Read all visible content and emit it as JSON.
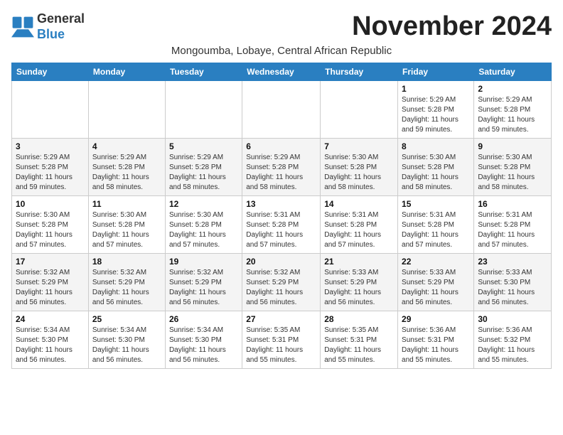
{
  "logo": {
    "text_general": "General",
    "text_blue": "Blue"
  },
  "title": "November 2024",
  "subtitle": "Mongoumba, Lobaye, Central African Republic",
  "days_of_week": [
    "Sunday",
    "Monday",
    "Tuesday",
    "Wednesday",
    "Thursday",
    "Friday",
    "Saturday"
  ],
  "weeks": [
    [
      {
        "day": "",
        "info": ""
      },
      {
        "day": "",
        "info": ""
      },
      {
        "day": "",
        "info": ""
      },
      {
        "day": "",
        "info": ""
      },
      {
        "day": "",
        "info": ""
      },
      {
        "day": "1",
        "info": "Sunrise: 5:29 AM\nSunset: 5:28 PM\nDaylight: 11 hours and 59 minutes."
      },
      {
        "day": "2",
        "info": "Sunrise: 5:29 AM\nSunset: 5:28 PM\nDaylight: 11 hours and 59 minutes."
      }
    ],
    [
      {
        "day": "3",
        "info": "Sunrise: 5:29 AM\nSunset: 5:28 PM\nDaylight: 11 hours and 59 minutes."
      },
      {
        "day": "4",
        "info": "Sunrise: 5:29 AM\nSunset: 5:28 PM\nDaylight: 11 hours and 58 minutes."
      },
      {
        "day": "5",
        "info": "Sunrise: 5:29 AM\nSunset: 5:28 PM\nDaylight: 11 hours and 58 minutes."
      },
      {
        "day": "6",
        "info": "Sunrise: 5:29 AM\nSunset: 5:28 PM\nDaylight: 11 hours and 58 minutes."
      },
      {
        "day": "7",
        "info": "Sunrise: 5:30 AM\nSunset: 5:28 PM\nDaylight: 11 hours and 58 minutes."
      },
      {
        "day": "8",
        "info": "Sunrise: 5:30 AM\nSunset: 5:28 PM\nDaylight: 11 hours and 58 minutes."
      },
      {
        "day": "9",
        "info": "Sunrise: 5:30 AM\nSunset: 5:28 PM\nDaylight: 11 hours and 58 minutes."
      }
    ],
    [
      {
        "day": "10",
        "info": "Sunrise: 5:30 AM\nSunset: 5:28 PM\nDaylight: 11 hours and 57 minutes."
      },
      {
        "day": "11",
        "info": "Sunrise: 5:30 AM\nSunset: 5:28 PM\nDaylight: 11 hours and 57 minutes."
      },
      {
        "day": "12",
        "info": "Sunrise: 5:30 AM\nSunset: 5:28 PM\nDaylight: 11 hours and 57 minutes."
      },
      {
        "day": "13",
        "info": "Sunrise: 5:31 AM\nSunset: 5:28 PM\nDaylight: 11 hours and 57 minutes."
      },
      {
        "day": "14",
        "info": "Sunrise: 5:31 AM\nSunset: 5:28 PM\nDaylight: 11 hours and 57 minutes."
      },
      {
        "day": "15",
        "info": "Sunrise: 5:31 AM\nSunset: 5:28 PM\nDaylight: 11 hours and 57 minutes."
      },
      {
        "day": "16",
        "info": "Sunrise: 5:31 AM\nSunset: 5:28 PM\nDaylight: 11 hours and 57 minutes."
      }
    ],
    [
      {
        "day": "17",
        "info": "Sunrise: 5:32 AM\nSunset: 5:29 PM\nDaylight: 11 hours and 56 minutes."
      },
      {
        "day": "18",
        "info": "Sunrise: 5:32 AM\nSunset: 5:29 PM\nDaylight: 11 hours and 56 minutes."
      },
      {
        "day": "19",
        "info": "Sunrise: 5:32 AM\nSunset: 5:29 PM\nDaylight: 11 hours and 56 minutes."
      },
      {
        "day": "20",
        "info": "Sunrise: 5:32 AM\nSunset: 5:29 PM\nDaylight: 11 hours and 56 minutes."
      },
      {
        "day": "21",
        "info": "Sunrise: 5:33 AM\nSunset: 5:29 PM\nDaylight: 11 hours and 56 minutes."
      },
      {
        "day": "22",
        "info": "Sunrise: 5:33 AM\nSunset: 5:29 PM\nDaylight: 11 hours and 56 minutes."
      },
      {
        "day": "23",
        "info": "Sunrise: 5:33 AM\nSunset: 5:30 PM\nDaylight: 11 hours and 56 minutes."
      }
    ],
    [
      {
        "day": "24",
        "info": "Sunrise: 5:34 AM\nSunset: 5:30 PM\nDaylight: 11 hours and 56 minutes."
      },
      {
        "day": "25",
        "info": "Sunrise: 5:34 AM\nSunset: 5:30 PM\nDaylight: 11 hours and 56 minutes."
      },
      {
        "day": "26",
        "info": "Sunrise: 5:34 AM\nSunset: 5:30 PM\nDaylight: 11 hours and 56 minutes."
      },
      {
        "day": "27",
        "info": "Sunrise: 5:35 AM\nSunset: 5:31 PM\nDaylight: 11 hours and 55 minutes."
      },
      {
        "day": "28",
        "info": "Sunrise: 5:35 AM\nSunset: 5:31 PM\nDaylight: 11 hours and 55 minutes."
      },
      {
        "day": "29",
        "info": "Sunrise: 5:36 AM\nSunset: 5:31 PM\nDaylight: 11 hours and 55 minutes."
      },
      {
        "day": "30",
        "info": "Sunrise: 5:36 AM\nSunset: 5:32 PM\nDaylight: 11 hours and 55 minutes."
      }
    ]
  ]
}
